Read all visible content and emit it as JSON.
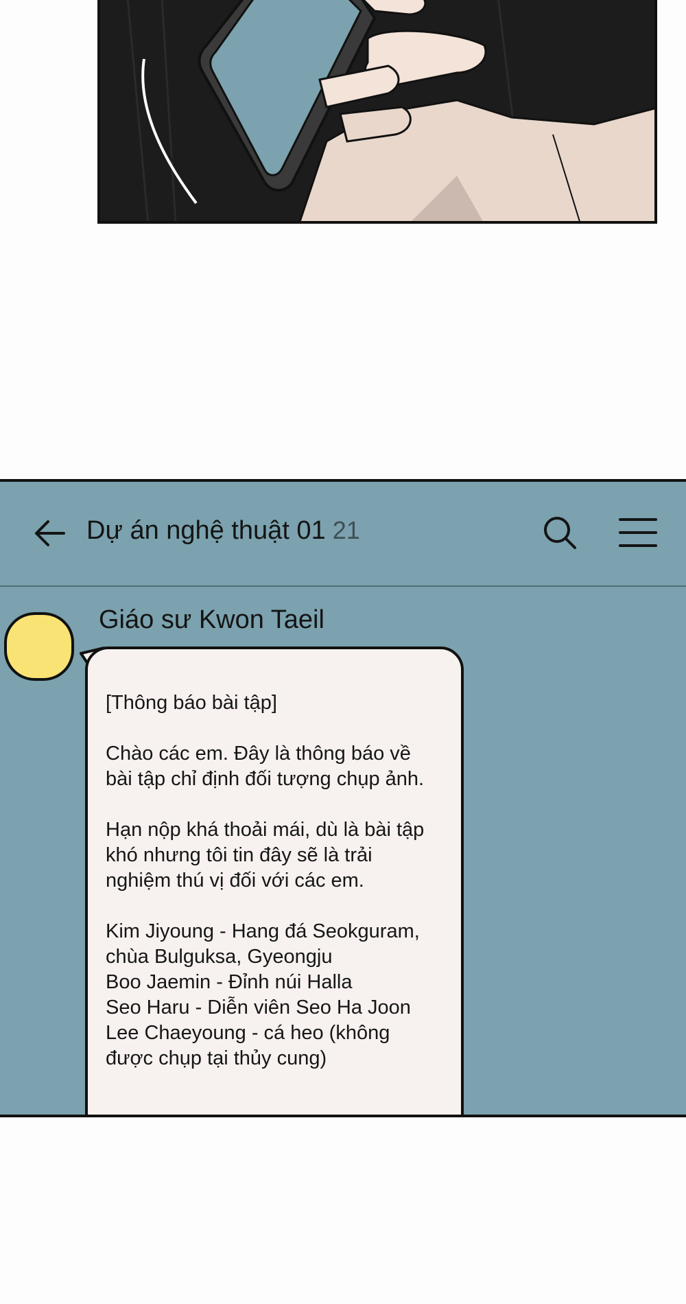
{
  "chat": {
    "back_icon": "arrow-left-icon",
    "title": "Dự án nghệ thuật 01",
    "member_count": "21",
    "search_icon": "search-icon",
    "menu_icon": "menu-icon",
    "avatar_color": "#f9e374",
    "header_bg": "#7ba2ae",
    "sender": "Giáo sư Kwon Taeil",
    "message_lines": [
      "[Thông báo bài tập]",
      "",
      "Chào các em. Đây là thông báo về",
      "bài tập chỉ định đối tượng chụp ảnh.",
      "",
      "Hạn nộp khá thoải mái, dù là bài tập",
      "khó nhưng tôi tin đây sẽ là trải",
      "nghiệm thú vị đối với các em.",
      "",
      "Kim Jiyoung - Hang đá Seokguram,",
      "chùa Bulguksa, Gyeongju",
      "Boo Jaemin - Đỉnh núi Halla",
      "Seo Haru - Diễn viên Seo Ha Joon",
      "Lee Chaeyoung - cá heo (không",
      "được chụp tại thủy cung)"
    ]
  }
}
